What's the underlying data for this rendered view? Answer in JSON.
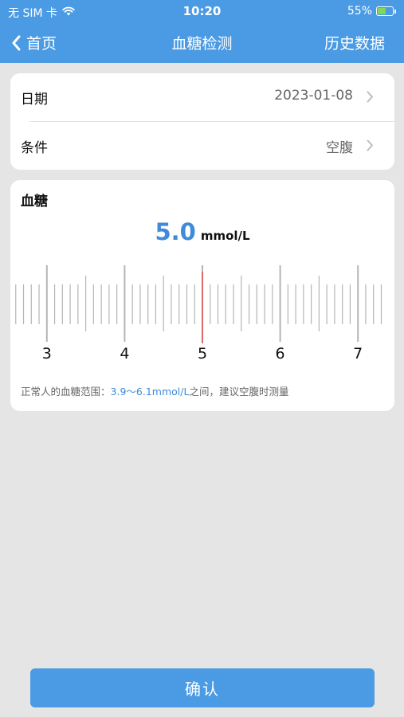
{
  "status_bar": {
    "carrier": "无 SIM 卡",
    "time": "10:20",
    "battery": "55%",
    "battery_level": 0.55
  },
  "nav": {
    "back_label": "首页",
    "title": "血糖检测",
    "history_label": "历史数据"
  },
  "form": {
    "date_label": "日期",
    "date_value": "2023-01-08",
    "condition_label": "条件",
    "condition_value": "空腹"
  },
  "glucose": {
    "label": "血糖",
    "value": "5.0",
    "unit": "mmol/L",
    "ruler": {
      "min_visible": 2.6,
      "max_visible": 7.4,
      "major_labels": [
        "3",
        "4",
        "5",
        "6",
        "7"
      ],
      "selected": 5.0,
      "indicator_color": "#e06a6a"
    },
    "tip_prefix": "正常人的血糖范围：",
    "tip_range": "3.9～6.1mmol/L",
    "tip_suffix": "之间，建议空腹时测量"
  },
  "confirm_label": "确认",
  "colors": {
    "primary": "#4a9be4",
    "accent_text": "#3d8bd9",
    "background": "#e5e5e5"
  }
}
